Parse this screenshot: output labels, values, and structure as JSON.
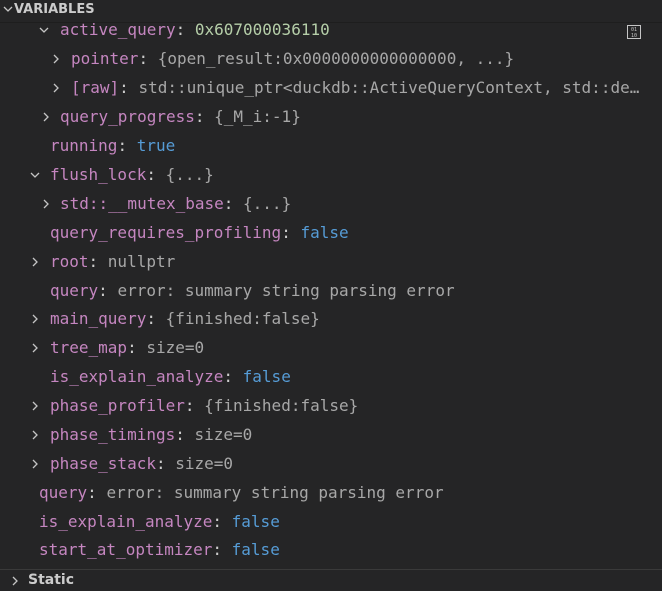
{
  "section_title": "VARIABLES",
  "footer_title": "Static",
  "rows": [
    {
      "name": "active_query",
      "value": "0x607000036110",
      "kind": "hex",
      "expanded": true,
      "twisty": true
    },
    {
      "name": "pointer",
      "value": "{open_result:0x0000000000000000, ...}",
      "kind": "plain",
      "expanded": false,
      "twisty": true
    },
    {
      "name": "[raw]",
      "value": "std::unique_ptr<duckdb::ActiveQueryContext, std::default_delete<duckdb::ActiveQueryContext>>",
      "kind": "plain",
      "expanded": false,
      "twisty": true
    },
    {
      "name": "query_progress",
      "value": "{_M_i:-1}",
      "kind": "plain",
      "expanded": false,
      "twisty": true
    },
    {
      "name": "running",
      "value": "true",
      "kind": "bool",
      "twisty": false
    },
    {
      "name": "flush_lock",
      "value": "{...}",
      "kind": "plain",
      "expanded": true,
      "twisty": true
    },
    {
      "name": "std::__mutex_base",
      "value": "{...}",
      "kind": "plain",
      "expanded": false,
      "twisty": true
    },
    {
      "name": "query_requires_profiling",
      "value": "false",
      "kind": "bool",
      "twisty": false
    },
    {
      "name": "root",
      "value": "nullptr",
      "kind": "plain",
      "expanded": false,
      "twisty": true
    },
    {
      "name": "query",
      "value": "error: summary string parsing error",
      "kind": "plain",
      "twisty": false
    },
    {
      "name": "main_query",
      "value": "{finished:false}",
      "kind": "plain",
      "expanded": false,
      "twisty": true
    },
    {
      "name": "tree_map",
      "value": "size=0",
      "kind": "plain",
      "expanded": false,
      "twisty": true
    },
    {
      "name": "is_explain_analyze",
      "value": "false",
      "kind": "bool",
      "twisty": false
    },
    {
      "name": "phase_profiler",
      "value": "{finished:false}",
      "kind": "plain",
      "expanded": false,
      "twisty": true
    },
    {
      "name": "phase_timings",
      "value": "size=0",
      "kind": "plain",
      "expanded": false,
      "twisty": true
    },
    {
      "name": "phase_stack",
      "value": "size=0",
      "kind": "plain",
      "expanded": false,
      "twisty": true
    },
    {
      "name": "query",
      "value": "error: summary string parsing error",
      "kind": "plain",
      "twisty": false
    },
    {
      "name": "is_explain_analyze",
      "value": "false",
      "kind": "bool",
      "twisty": false
    },
    {
      "name": "start_at_optimizer",
      "value": "false",
      "kind": "bool",
      "twisty": false
    }
  ],
  "colors": {
    "name": "#c586c0",
    "bool": "#569cd6",
    "hex": "#b5cea8",
    "background": "#252526"
  },
  "icons": {
    "expanded": "chevron-down-icon",
    "collapsed": "chevron-right-icon",
    "hex_toggle": "binary-hex-icon"
  }
}
